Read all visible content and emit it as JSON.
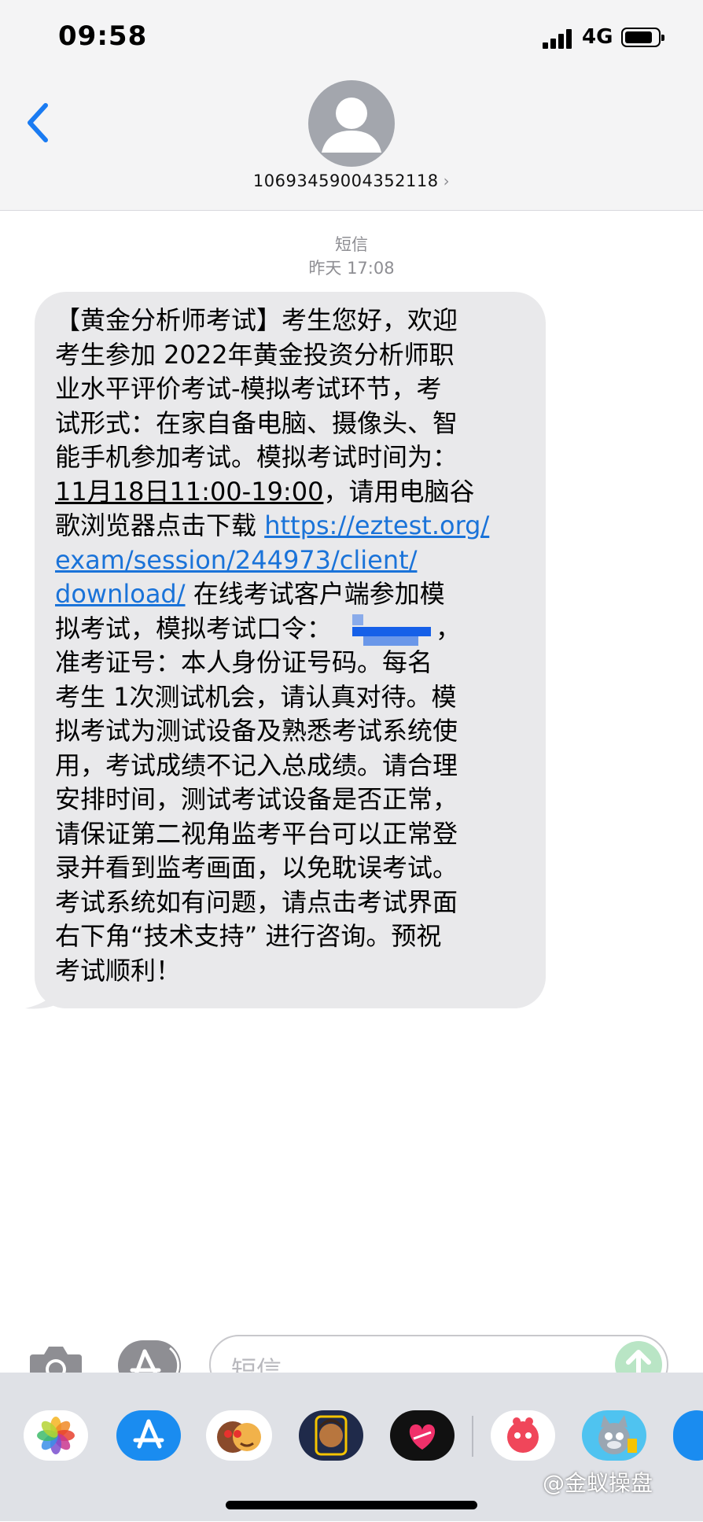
{
  "status_bar": {
    "time": "09:58",
    "network": "4G"
  },
  "header": {
    "contact_number": "10693459004352118",
    "contact_chevron": "›"
  },
  "thread": {
    "service_label": "短信",
    "timestamp": "昨天 17:08"
  },
  "message": {
    "lines": [
      "【黄金分析师考试】考生您好，欢迎",
      "考生参加 2022年黄金投资分析师职",
      "业水平评价考试-模拟考试环节，考",
      "试形式：在家自备电脑、摄像头、智",
      "能手机参加考试。模拟考试时间为："
    ],
    "line6_date": "11月18日11:00-19:00",
    "line6_rest": "，请用电脑谷",
    "line7_text": "歌浏览器点击下载 ",
    "link_part1": "https://eztest.org/",
    "link_part2": "exam/session/244973/client/",
    "link_part3": "download/",
    "line9_rest": " 在线考试客户端参加模",
    "line10_text": "拟考试，模拟考试口令：",
    "line10_end": "，",
    "tail_lines": [
      "准考证号：本人身份证号码。每名",
      "考生 1次测试机会，请认真对待。模",
      "拟考试为测试设备及熟悉考试系统使",
      "用，考试成绩不记入总成绩。请合理",
      "安排时间，测试考试设备是否正常，",
      "请保证第二视角监考平台可以正常登",
      "录并看到监考画面，以免耽误考试。",
      "考试系统如有问题，请点击考试界面",
      "右下角“技术支持” 进行咨询。预祝",
      "考试顺利！"
    ]
  },
  "input_bar": {
    "placeholder": "短信"
  },
  "watermark": "@金蚁操盘",
  "colors": {
    "link": "#1a73d9",
    "bubble": "#e9e9eb",
    "ios_blue": "#1a7bf2",
    "header_bg": "#f4f4f5"
  },
  "icons": [
    "back-chevron-icon",
    "contact-avatar-icon",
    "camera-icon",
    "appstore-icon",
    "send-arrow-icon",
    "photos-app-icon",
    "memoji-stickers-icon",
    "memoji-icon",
    "digital-touch-icon",
    "red-app-icon",
    "talking-tom-icon"
  ]
}
